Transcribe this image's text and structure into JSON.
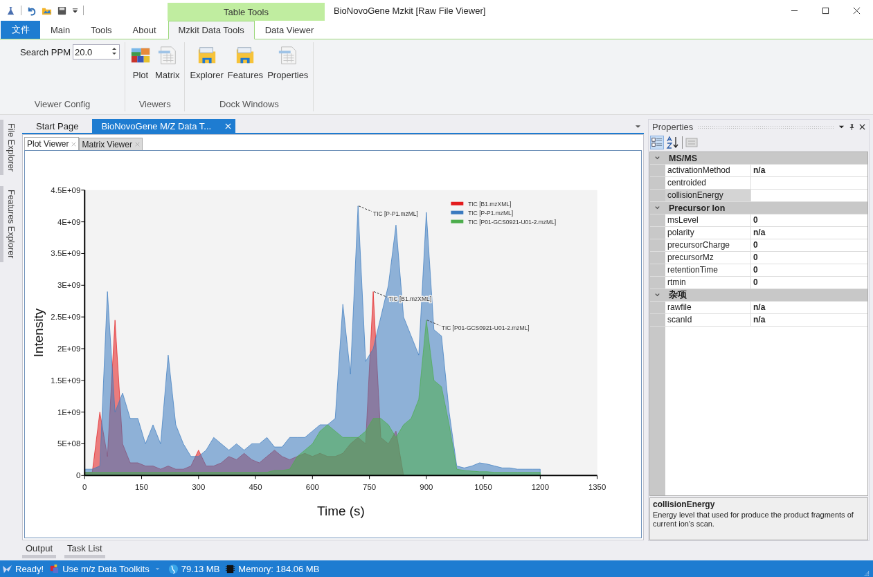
{
  "window": {
    "title": "BioNovoGene Mzkit [Raw File Viewer]"
  },
  "contextual_group": {
    "label": "Table Tools"
  },
  "ribbon_tabs": [
    {
      "label": "文件",
      "kind": "file",
      "selected": false
    },
    {
      "label": "Main",
      "kind": "plain",
      "selected": false
    },
    {
      "label": "Tools",
      "kind": "plain",
      "selected": false
    },
    {
      "label": "About",
      "kind": "plain",
      "selected": false
    },
    {
      "label": "Mzkit Data Tools",
      "kind": "contextual",
      "selected": true
    },
    {
      "label": "Data Viewer",
      "kind": "contextual",
      "selected": false
    }
  ],
  "ribbon_groups": [
    {
      "title": "Viewer Config",
      "items": [
        {
          "kind": "spin",
          "label": "Search PPM",
          "value": "20.0"
        }
      ]
    },
    {
      "title": "Viewers",
      "items": [
        {
          "kind": "image-button",
          "label": "Plot"
        },
        {
          "kind": "sheet-button",
          "label": "Matrix"
        }
      ]
    },
    {
      "title": "Dock Windows",
      "items": [
        {
          "kind": "folder-button",
          "label": "Explorer"
        },
        {
          "kind": "folder-button",
          "label": "Features"
        },
        {
          "kind": "sheet-button",
          "label": "Properties"
        }
      ]
    }
  ],
  "side_tabs": [
    "File Explorer",
    "Features Explorer"
  ],
  "document_tabs": [
    {
      "label": "Start Page",
      "selected": false
    },
    {
      "label": "BioNovoGene M/Z Data T...",
      "selected": true
    }
  ],
  "viewer_tabs": [
    {
      "label": "Plot Viewer",
      "selected": true
    },
    {
      "label": "Matrix Viewer",
      "selected": false
    }
  ],
  "chart_data": {
    "type": "area",
    "xlabel": "Time (s)",
    "ylabel": "Intensity",
    "x": [
      0,
      20,
      40,
      60,
      80,
      100,
      120,
      140,
      160,
      180,
      200,
      220,
      240,
      260,
      280,
      300,
      320,
      340,
      360,
      380,
      400,
      420,
      440,
      460,
      480,
      500,
      520,
      540,
      560,
      580,
      600,
      620,
      640,
      660,
      680,
      700,
      720,
      740,
      760,
      780,
      800,
      820,
      840,
      860,
      880,
      900,
      920,
      940,
      960,
      980,
      1000,
      1020,
      1040,
      1060,
      1080,
      1100,
      1120,
      1140,
      1160,
      1180,
      1200
    ],
    "series": [
      {
        "name": "TIC [B1.mzXML]",
        "color": "#e31a1c",
        "values": [
          50000000.0,
          50000000.0,
          1000000000.0,
          300000000.0,
          2450000000.0,
          500000000.0,
          200000000.0,
          200000000.0,
          150000000.0,
          150000000.0,
          100000000.0,
          150000000.0,
          100000000.0,
          100000000.0,
          150000000.0,
          400000000.0,
          150000000.0,
          150000000.0,
          200000000.0,
          300000000.0,
          250000000.0,
          350000000.0,
          250000000.0,
          200000000.0,
          300000000.0,
          400000000.0,
          300000000.0,
          250000000.0,
          300000000.0,
          350000000.0,
          300000000.0,
          350000000.0,
          300000000.0,
          300000000.0,
          350000000.0,
          500000000.0,
          600000000.0,
          500000000.0,
          2900000000.0,
          600000000.0,
          500000000.0,
          700000000.0,
          0,
          null,
          null,
          null,
          null,
          null,
          null,
          null,
          null,
          null,
          null,
          null,
          null,
          null,
          null,
          null,
          null,
          null,
          null
        ]
      },
      {
        "name": "TIC [P-P1.mzML]",
        "color": "#3a7abf",
        "values": [
          100000000.0,
          100000000.0,
          150000000.0,
          2900000000.0,
          1000000000.0,
          1300000000.0,
          900000000.0,
          900000000.0,
          500000000.0,
          800000000.0,
          500000000.0,
          1900000000.0,
          800000000.0,
          500000000.0,
          300000000.0,
          300000000.0,
          400000000.0,
          600000000.0,
          500000000.0,
          400000000.0,
          500000000.0,
          400000000.0,
          500000000.0,
          500000000.0,
          600000000.0,
          450000000.0,
          450000000.0,
          600000000.0,
          600000000.0,
          600000000.0,
          700000000.0,
          800000000.0,
          800000000.0,
          900000000.0,
          2700000000.0,
          1600000000.0,
          4250000000.0,
          1800000000.0,
          2000000000.0,
          2500000000.0,
          3000000000.0,
          3950000000.0,
          2500000000.0,
          2200000000.0,
          1900000000.0,
          4150000000.0,
          2300000000.0,
          2200000000.0,
          1000000000.0,
          150000000.0,
          120000000.0,
          150000000.0,
          200000000.0,
          180000000.0,
          150000000.0,
          120000000.0,
          120000000.0,
          100000000.0,
          100000000.0,
          100000000.0,
          100000000.0
        ]
      },
      {
        "name": "TIC [P01-GCS0921-U01-2.mzML]",
        "color": "#4cad4c",
        "values": [
          50000000.0,
          50000000.0,
          50000000.0,
          50000000.0,
          50000000.0,
          50000000.0,
          50000000.0,
          50000000.0,
          50000000.0,
          50000000.0,
          50000000.0,
          50000000.0,
          50000000.0,
          50000000.0,
          50000000.0,
          50000000.0,
          50000000.0,
          50000000.0,
          50000000.0,
          50000000.0,
          50000000.0,
          50000000.0,
          50000000.0,
          50000000.0,
          50000000.0,
          80000000.0,
          80000000.0,
          100000000.0,
          300000000.0,
          400000000.0,
          500000000.0,
          700000000.0,
          800000000.0,
          700000000.0,
          600000000.0,
          600000000.0,
          600000000.0,
          700000000.0,
          900000000.0,
          900000000.0,
          800000000.0,
          600000000.0,
          800000000.0,
          900000000.0,
          1200000000.0,
          2450000000.0,
          1500000000.0,
          1400000000.0,
          800000000.0,
          100000000.0,
          80000000.0,
          70000000.0,
          60000000.0,
          60000000.0,
          50000000.0,
          50000000.0,
          50000000.0,
          50000000.0,
          50000000.0,
          50000000.0,
          50000000.0
        ]
      }
    ],
    "xlim": [
      0,
      1350
    ],
    "ylim": [
      0,
      4500000000.0
    ],
    "xticks": [
      0,
      150,
      300,
      450,
      600,
      750,
      900,
      1050,
      1200,
      1350
    ],
    "yticks": [
      {
        "value": 0,
        "label": "0"
      },
      {
        "value": 500000000.0,
        "label": "5E+08"
      },
      {
        "value": 1000000000.0,
        "label": "1E+09"
      },
      {
        "value": 1500000000.0,
        "label": "1.5E+09"
      },
      {
        "value": 2000000000.0,
        "label": "2E+09"
      },
      {
        "value": 2500000000.0,
        "label": "2.5E+09"
      },
      {
        "value": 3000000000.0,
        "label": "3E+09"
      },
      {
        "value": 3500000000.0,
        "label": "3.5E+09"
      },
      {
        "value": 4000000000.0,
        "label": "4E+09"
      },
      {
        "value": 4500000000.0,
        "label": "4.5E+09"
      }
    ],
    "legend": true,
    "annotations": [
      {
        "text": "TIC [P-P1.mzML]",
        "x": 720,
        "y": 4250000000.0
      },
      {
        "text": "TIC [B1.mzXML]",
        "x": 760,
        "y": 2900000000.0
      },
      {
        "text": "TIC [P01-GCS0921-U01-2.mzML]",
        "x": 900,
        "y": 2450000000.0
      }
    ]
  },
  "properties": {
    "title": "Properties",
    "categories": [
      {
        "name": "MS/MS",
        "expanded": true,
        "rows": [
          {
            "name": "activationMethod",
            "value": "n/a",
            "selected": false
          },
          {
            "name": "centroided",
            "selected": false
          },
          {
            "name": "collisionEnergy",
            "selected": true
          }
        ]
      },
      {
        "name": "Precursor Ion",
        "expanded": true,
        "rows": [
          {
            "name": "msLevel",
            "value": "0",
            "selected": false
          },
          {
            "name": "polarity",
            "value": "n/a",
            "selected": false
          },
          {
            "name": "precursorCharge",
            "value": "0",
            "selected": false
          },
          {
            "name": "precursorMz",
            "value": "0",
            "selected": false
          },
          {
            "name": "retentionTime",
            "value": "0",
            "selected": false
          },
          {
            "name": "rtmin",
            "value": "0",
            "selected": false
          }
        ]
      },
      {
        "name": "杂项",
        "expanded": true,
        "rows": [
          {
            "name": "rawfile",
            "value": "n/a",
            "selected": false
          },
          {
            "name": "scanId",
            "value": "n/a",
            "selected": false
          }
        ]
      }
    ],
    "description": {
      "title": "collisionEnergy",
      "text": "Energy level that used for produce the product fragments of current ion's scan."
    }
  },
  "bottom_tabs": [
    "Output",
    "Task List"
  ],
  "status_bar": {
    "ready": "Ready!",
    "mode": "Use m/z Data Toolkits",
    "disk": "79.13 MB",
    "memory": "Memory: 184.06 MB"
  }
}
